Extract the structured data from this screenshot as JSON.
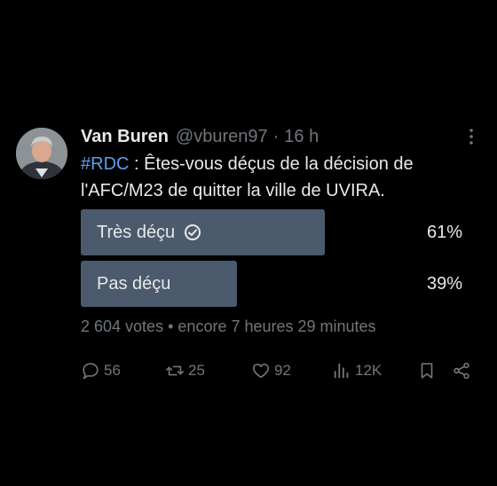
{
  "post": {
    "author_name": "Van Buren",
    "author_handle": "@vburen97",
    "separator": "·",
    "time": "16 h",
    "hashtag": "#RDC",
    "text": " : Êtes-vous déçus de la décision de l'AFC/M23 de quitter la ville de UVIRA."
  },
  "poll": {
    "options": [
      {
        "label": "Très déçu",
        "percent_label": "61%",
        "percent": 61,
        "selected": true
      },
      {
        "label": "Pas déçu",
        "percent_label": "39%",
        "percent": 39,
        "selected": false
      }
    ],
    "votes": "2 604 votes",
    "meta_separator": "•",
    "remaining": "encore 7 heures 29 minutes"
  },
  "actions": {
    "replies": "56",
    "reposts": "25",
    "likes": "92",
    "views": "12K"
  },
  "icons": {
    "more": "more-vertical-icon",
    "check": "check-circle-icon",
    "reply": "reply-icon",
    "repost": "repost-icon",
    "like": "heart-icon",
    "views": "views-icon",
    "bookmark": "bookmark-icon",
    "share": "share-icon"
  },
  "colors": {
    "background": "#000000",
    "text": "#e7e9ea",
    "muted": "#71767b",
    "hashtag": "#5aa0ec",
    "poll_bar": "#4b5a6c"
  }
}
